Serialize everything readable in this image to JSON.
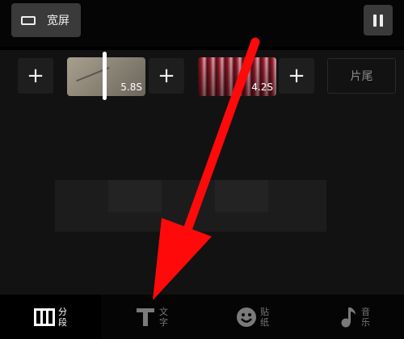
{
  "toolbar": {
    "aspect_label": "宽屏",
    "aspect_icon": "widescreen-icon",
    "pause_icon": "pause-icon"
  },
  "timeline": {
    "add_icon_text": "+",
    "clips": [
      {
        "duration": "5.8S"
      },
      {
        "duration": "4.2S"
      }
    ],
    "tail_label": "片尾"
  },
  "bottom_nav": [
    {
      "chars": [
        "分",
        "段"
      ],
      "icon": "segment-icon",
      "active": true
    },
    {
      "chars": [
        "文",
        "字"
      ],
      "icon": "text-icon",
      "active": false
    },
    {
      "chars": [
        "贴",
        "纸"
      ],
      "icon": "sticker-icon",
      "active": false
    },
    {
      "chars": [
        "音",
        "乐"
      ],
      "icon": "music-icon",
      "active": false
    }
  ],
  "annotation": {
    "color": "#ff0a0a"
  }
}
